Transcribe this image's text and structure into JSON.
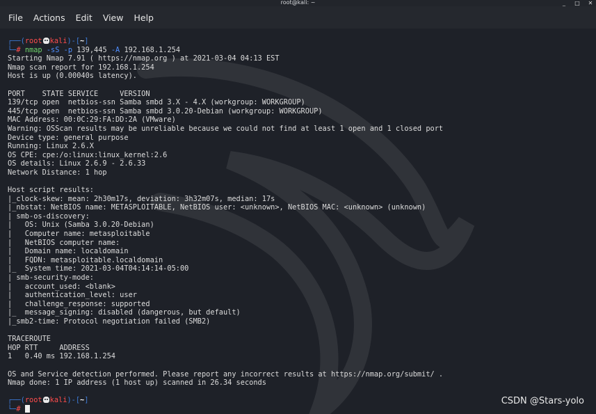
{
  "window": {
    "title": "root@kali: ~",
    "controls": [
      "_",
      "□",
      "✕"
    ]
  },
  "menu": [
    "File",
    "Actions",
    "Edit",
    "View",
    "Help"
  ],
  "prompt": {
    "top_left": "┌──(",
    "user": "root",
    "host": "kali",
    "mid": ")-[",
    "dir": "~",
    "end": "]",
    "bottom": "└─",
    "symbol": "#"
  },
  "command": {
    "name": "nmap",
    "flag1": "-sS",
    "flag2": "-p",
    "ports": "139,445",
    "flag3": "-A",
    "target": "192.168.1.254"
  },
  "output": [
    "Starting Nmap 7.91 ( https://nmap.org ) at 2021-03-04 04:13 EST",
    "Nmap scan report for 192.168.1.254",
    "Host is up (0.00040s latency).",
    "",
    "PORT    STATE SERVICE     VERSION",
    "139/tcp open  netbios-ssn Samba smbd 3.X - 4.X (workgroup: WORKGROUP)",
    "445/tcp open  netbios-ssn Samba smbd 3.0.20-Debian (workgroup: WORKGROUP)",
    "MAC Address: 00:0C:29:FA:DD:2A (VMware)",
    "Warning: OSScan results may be unreliable because we could not find at least 1 open and 1 closed port",
    "Device type: general purpose",
    "Running: Linux 2.6.X",
    "OS CPE: cpe:/o:linux:linux_kernel:2.6",
    "OS details: Linux 2.6.9 - 2.6.33",
    "Network Distance: 1 hop",
    "",
    "Host script results:",
    "|_clock-skew: mean: 2h30m17s, deviation: 3h32m07s, median: 17s",
    "|_nbstat: NetBIOS name: METASPLOITABLE, NetBIOS user: <unknown>, NetBIOS MAC: <unknown> (unknown)",
    "| smb-os-discovery: ",
    "|   OS: Unix (Samba 3.0.20-Debian)",
    "|   Computer name: metasploitable",
    "|   NetBIOS computer name: ",
    "|   Domain name: localdomain",
    "|   FQDN: metasploitable.localdomain",
    "|_  System time: 2021-03-04T04:14:14-05:00",
    "| smb-security-mode: ",
    "|   account_used: <blank>",
    "|   authentication_level: user",
    "|   challenge_response: supported",
    "|_  message_signing: disabled (dangerous, but default)",
    "|_smb2-time: Protocol negotiation failed (SMB2)",
    "",
    "TRACEROUTE",
    "HOP RTT     ADDRESS",
    "1   0.40 ms 192.168.1.254",
    "",
    "OS and Service detection performed. Please report any incorrect results at https://nmap.org/submit/ .",
    "Nmap done: 1 IP address (1 host up) scanned in 26.34 seconds",
    ""
  ],
  "watermark": "CSDN @Stars-yolo"
}
